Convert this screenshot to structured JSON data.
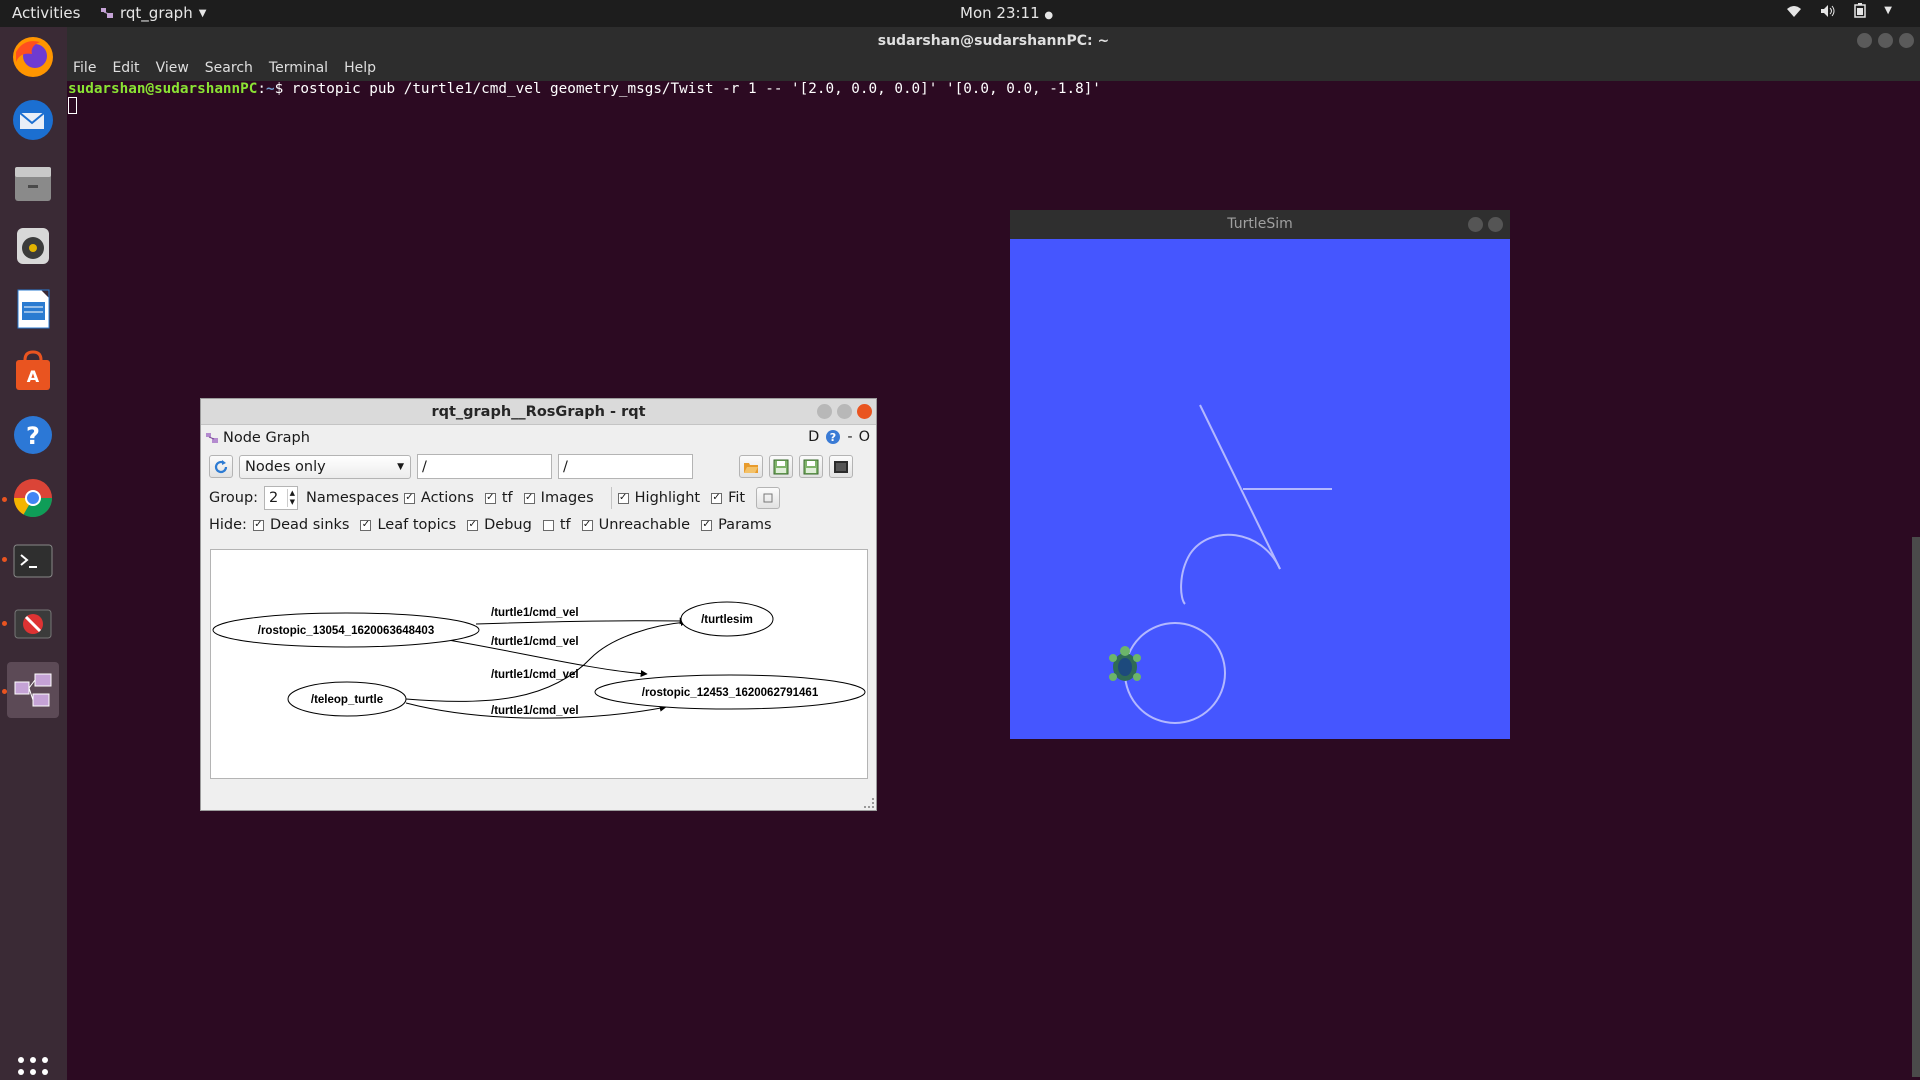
{
  "topbar": {
    "activities": "Activities",
    "app_name": "rqt_graph",
    "clock": "Mon 23:11"
  },
  "dock": {
    "items": [
      "firefox",
      "thunderbird",
      "files",
      "rhythmbox",
      "libreoffice-writer",
      "ubuntu-software",
      "help",
      "chrome",
      "terminal",
      "blocked-app",
      "rqt"
    ]
  },
  "terminal": {
    "title": "sudarshan@sudarshannPC: ~",
    "menu": [
      "File",
      "Edit",
      "View",
      "Search",
      "Terminal",
      "Help"
    ],
    "prompt_user": "sudarshan@sudarshannPC",
    "prompt_sep": ":",
    "prompt_path": "~",
    "prompt_sign": "$",
    "command": " rostopic pub /turtle1/cmd_vel geometry_msgs/Twist -r 1 -- '[2.0, 0.0, 0.0]' '[0.0, 0.0, -1.8]'"
  },
  "turtlesim": {
    "title": "TurtleSim",
    "background": "#4556ff",
    "path_color": "#b3b8ff"
  },
  "rqt": {
    "title": "rqt_graph__RosGraph - rqt",
    "plugin_title": "Node Graph",
    "header_right": [
      "D",
      "-",
      "O"
    ],
    "mode": "Nodes only",
    "filter1": "/",
    "filter2": "/",
    "group_label": "Group:",
    "group_value": "2",
    "options": [
      {
        "label": "Namespaces",
        "checked": true
      },
      {
        "label": "Actions",
        "checked": true
      },
      {
        "label": "tf",
        "checked": true
      },
      {
        "label": "Images",
        "checked": true
      },
      {
        "label": "Highlight",
        "checked": true
      },
      {
        "label": "Fit",
        "checked": true
      }
    ],
    "hide_label": "Hide:",
    "hide_options": [
      {
        "label": "Dead sinks",
        "checked": true
      },
      {
        "label": "Leaf topics",
        "checked": true
      },
      {
        "label": "Debug",
        "checked": true
      },
      {
        "label": "tf",
        "checked": false
      },
      {
        "label": "Unreachable",
        "checked": true
      },
      {
        "label": "Params",
        "checked": true
      }
    ],
    "graph": {
      "nodes": {
        "rostopic1": "/rostopic_13054_1620063648403",
        "turtlesim": "/turtlesim",
        "teleop": "/teleop_turtle",
        "rostopic2": "/rostopic_12453_1620062791461"
      },
      "edges": [
        "/turtle1/cmd_vel",
        "/turtle1/cmd_vel",
        "/turtle1/cmd_vel",
        "/turtle1/cmd_vel"
      ]
    }
  }
}
